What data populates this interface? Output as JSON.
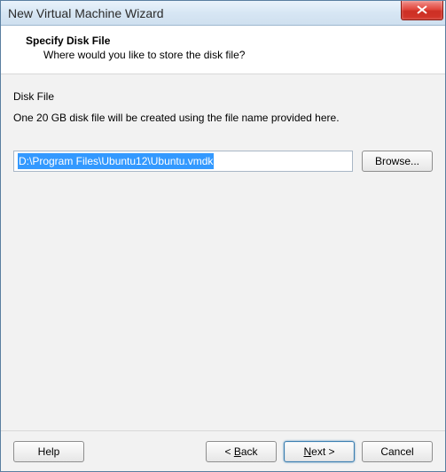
{
  "window": {
    "title": "New Virtual Machine Wizard"
  },
  "header": {
    "title": "Specify Disk File",
    "subtitle": "Where would you like to store the disk file?"
  },
  "body": {
    "section_label": "Disk File",
    "description": "One 20 GB disk file will be created using the file name provided here.",
    "path_value": "D:\\Program Files\\Ubuntu12\\Ubuntu.vmdk",
    "browse_label": "Browse..."
  },
  "buttons": {
    "help": "Help",
    "back_prefix": "< ",
    "back_mnemonic": "B",
    "back_rest": "ack",
    "next_mnemonic": "N",
    "next_rest": "ext >",
    "cancel": "Cancel"
  }
}
